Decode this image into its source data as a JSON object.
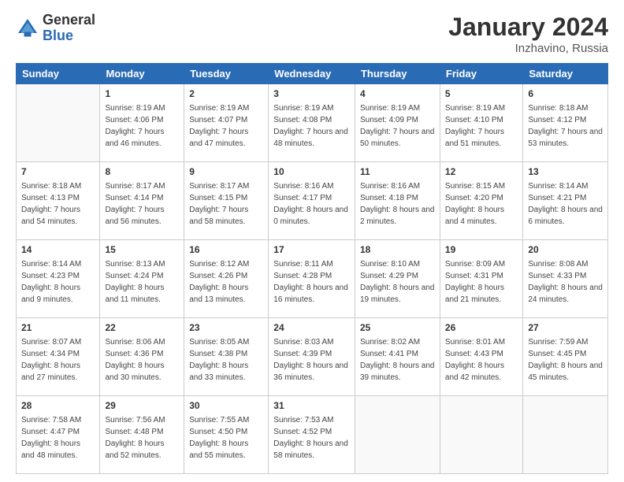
{
  "logo": {
    "general": "General",
    "blue": "Blue"
  },
  "title": "January 2024",
  "subtitle": "Inzhavino, Russia",
  "headers": [
    "Sunday",
    "Monday",
    "Tuesday",
    "Wednesday",
    "Thursday",
    "Friday",
    "Saturday"
  ],
  "weeks": [
    [
      {
        "day": "",
        "sunrise": "",
        "sunset": "",
        "daylight": ""
      },
      {
        "day": "1",
        "sunrise": "Sunrise: 8:19 AM",
        "sunset": "Sunset: 4:06 PM",
        "daylight": "Daylight: 7 hours and 46 minutes."
      },
      {
        "day": "2",
        "sunrise": "Sunrise: 8:19 AM",
        "sunset": "Sunset: 4:07 PM",
        "daylight": "Daylight: 7 hours and 47 minutes."
      },
      {
        "day": "3",
        "sunrise": "Sunrise: 8:19 AM",
        "sunset": "Sunset: 4:08 PM",
        "daylight": "Daylight: 7 hours and 48 minutes."
      },
      {
        "day": "4",
        "sunrise": "Sunrise: 8:19 AM",
        "sunset": "Sunset: 4:09 PM",
        "daylight": "Daylight: 7 hours and 50 minutes."
      },
      {
        "day": "5",
        "sunrise": "Sunrise: 8:19 AM",
        "sunset": "Sunset: 4:10 PM",
        "daylight": "Daylight: 7 hours and 51 minutes."
      },
      {
        "day": "6",
        "sunrise": "Sunrise: 8:18 AM",
        "sunset": "Sunset: 4:12 PM",
        "daylight": "Daylight: 7 hours and 53 minutes."
      }
    ],
    [
      {
        "day": "7",
        "sunrise": "Sunrise: 8:18 AM",
        "sunset": "Sunset: 4:13 PM",
        "daylight": "Daylight: 7 hours and 54 minutes."
      },
      {
        "day": "8",
        "sunrise": "Sunrise: 8:17 AM",
        "sunset": "Sunset: 4:14 PM",
        "daylight": "Daylight: 7 hours and 56 minutes."
      },
      {
        "day": "9",
        "sunrise": "Sunrise: 8:17 AM",
        "sunset": "Sunset: 4:15 PM",
        "daylight": "Daylight: 7 hours and 58 minutes."
      },
      {
        "day": "10",
        "sunrise": "Sunrise: 8:16 AM",
        "sunset": "Sunset: 4:17 PM",
        "daylight": "Daylight: 8 hours and 0 minutes."
      },
      {
        "day": "11",
        "sunrise": "Sunrise: 8:16 AM",
        "sunset": "Sunset: 4:18 PM",
        "daylight": "Daylight: 8 hours and 2 minutes."
      },
      {
        "day": "12",
        "sunrise": "Sunrise: 8:15 AM",
        "sunset": "Sunset: 4:20 PM",
        "daylight": "Daylight: 8 hours and 4 minutes."
      },
      {
        "day": "13",
        "sunrise": "Sunrise: 8:14 AM",
        "sunset": "Sunset: 4:21 PM",
        "daylight": "Daylight: 8 hours and 6 minutes."
      }
    ],
    [
      {
        "day": "14",
        "sunrise": "Sunrise: 8:14 AM",
        "sunset": "Sunset: 4:23 PM",
        "daylight": "Daylight: 8 hours and 9 minutes."
      },
      {
        "day": "15",
        "sunrise": "Sunrise: 8:13 AM",
        "sunset": "Sunset: 4:24 PM",
        "daylight": "Daylight: 8 hours and 11 minutes."
      },
      {
        "day": "16",
        "sunrise": "Sunrise: 8:12 AM",
        "sunset": "Sunset: 4:26 PM",
        "daylight": "Daylight: 8 hours and 13 minutes."
      },
      {
        "day": "17",
        "sunrise": "Sunrise: 8:11 AM",
        "sunset": "Sunset: 4:28 PM",
        "daylight": "Daylight: 8 hours and 16 minutes."
      },
      {
        "day": "18",
        "sunrise": "Sunrise: 8:10 AM",
        "sunset": "Sunset: 4:29 PM",
        "daylight": "Daylight: 8 hours and 19 minutes."
      },
      {
        "day": "19",
        "sunrise": "Sunrise: 8:09 AM",
        "sunset": "Sunset: 4:31 PM",
        "daylight": "Daylight: 8 hours and 21 minutes."
      },
      {
        "day": "20",
        "sunrise": "Sunrise: 8:08 AM",
        "sunset": "Sunset: 4:33 PM",
        "daylight": "Daylight: 8 hours and 24 minutes."
      }
    ],
    [
      {
        "day": "21",
        "sunrise": "Sunrise: 8:07 AM",
        "sunset": "Sunset: 4:34 PM",
        "daylight": "Daylight: 8 hours and 27 minutes."
      },
      {
        "day": "22",
        "sunrise": "Sunrise: 8:06 AM",
        "sunset": "Sunset: 4:36 PM",
        "daylight": "Daylight: 8 hours and 30 minutes."
      },
      {
        "day": "23",
        "sunrise": "Sunrise: 8:05 AM",
        "sunset": "Sunset: 4:38 PM",
        "daylight": "Daylight: 8 hours and 33 minutes."
      },
      {
        "day": "24",
        "sunrise": "Sunrise: 8:03 AM",
        "sunset": "Sunset: 4:39 PM",
        "daylight": "Daylight: 8 hours and 36 minutes."
      },
      {
        "day": "25",
        "sunrise": "Sunrise: 8:02 AM",
        "sunset": "Sunset: 4:41 PM",
        "daylight": "Daylight: 8 hours and 39 minutes."
      },
      {
        "day": "26",
        "sunrise": "Sunrise: 8:01 AM",
        "sunset": "Sunset: 4:43 PM",
        "daylight": "Daylight: 8 hours and 42 minutes."
      },
      {
        "day": "27",
        "sunrise": "Sunrise: 7:59 AM",
        "sunset": "Sunset: 4:45 PM",
        "daylight": "Daylight: 8 hours and 45 minutes."
      }
    ],
    [
      {
        "day": "28",
        "sunrise": "Sunrise: 7:58 AM",
        "sunset": "Sunset: 4:47 PM",
        "daylight": "Daylight: 8 hours and 48 minutes."
      },
      {
        "day": "29",
        "sunrise": "Sunrise: 7:56 AM",
        "sunset": "Sunset: 4:48 PM",
        "daylight": "Daylight: 8 hours and 52 minutes."
      },
      {
        "day": "30",
        "sunrise": "Sunrise: 7:55 AM",
        "sunset": "Sunset: 4:50 PM",
        "daylight": "Daylight: 8 hours and 55 minutes."
      },
      {
        "day": "31",
        "sunrise": "Sunrise: 7:53 AM",
        "sunset": "Sunset: 4:52 PM",
        "daylight": "Daylight: 8 hours and 58 minutes."
      },
      {
        "day": "",
        "sunrise": "",
        "sunset": "",
        "daylight": ""
      },
      {
        "day": "",
        "sunrise": "",
        "sunset": "",
        "daylight": ""
      },
      {
        "day": "",
        "sunrise": "",
        "sunset": "",
        "daylight": ""
      }
    ]
  ]
}
